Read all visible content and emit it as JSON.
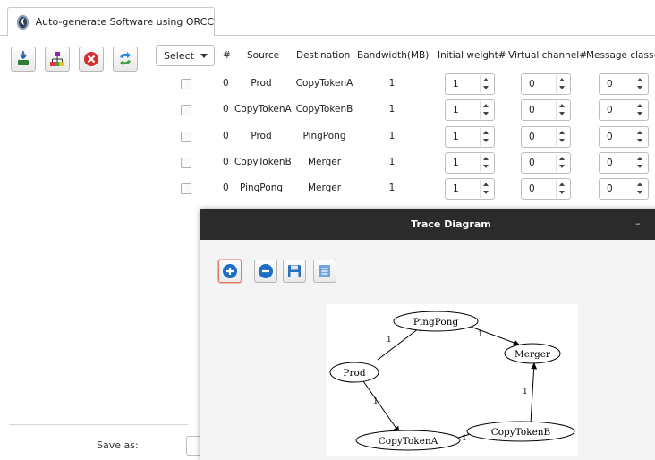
{
  "tab": {
    "title": "Auto-generate Software using ORCC"
  },
  "toolbar": {
    "icons": [
      "import-icon",
      "hierarchy-icon",
      "delete-icon",
      "refresh-icon"
    ]
  },
  "select": {
    "label": "Select"
  },
  "columns": {
    "index": "#",
    "source": "Source",
    "destination": "Destination",
    "bandwidth": "Bandwidth(MB)",
    "initial_weight": "Initial weight#",
    "virtual_channel": "Virtual channel#",
    "message_class": "Message class#"
  },
  "rows": [
    {
      "index": "0",
      "source": "Prod",
      "destination": "CopyTokenA",
      "bandwidth": "1",
      "initial_weight": "1",
      "virtual_channel": "0",
      "message_class": "0"
    },
    {
      "index": "0",
      "source": "CopyTokenA",
      "destination": "CopyTokenB",
      "bandwidth": "1",
      "initial_weight": "1",
      "virtual_channel": "0",
      "message_class": "0"
    },
    {
      "index": "0",
      "source": "Prod",
      "destination": "PingPong",
      "bandwidth": "1",
      "initial_weight": "1",
      "virtual_channel": "0",
      "message_class": "0"
    },
    {
      "index": "0",
      "source": "CopyTokenB",
      "destination": "Merger",
      "bandwidth": "1",
      "initial_weight": "1",
      "virtual_channel": "0",
      "message_class": "0"
    },
    {
      "index": "0",
      "source": "PingPong",
      "destination": "Merger",
      "bandwidth": "1",
      "initial_weight": "1",
      "virtual_channel": "0",
      "message_class": "0"
    }
  ],
  "footer": {
    "save_as_label": "Save as:"
  },
  "trace_window": {
    "title": "Trace Diagram",
    "minimize": "–",
    "tools": [
      "zoom-in-icon",
      "zoom-out-icon",
      "save-icon",
      "document-icon"
    ]
  },
  "graph": {
    "nodes": {
      "pingpong": "PingPong",
      "merger": "Merger",
      "prod": "Prod",
      "copytokena": "CopyTokenA",
      "copytokenb": "CopyTokenB"
    },
    "edges": {
      "prod_pingpong": "1",
      "pingpong_merger": "1",
      "copytokenb_merger": "1",
      "prod_copytokena": "1",
      "copytokena_copytokenb": "1"
    }
  }
}
